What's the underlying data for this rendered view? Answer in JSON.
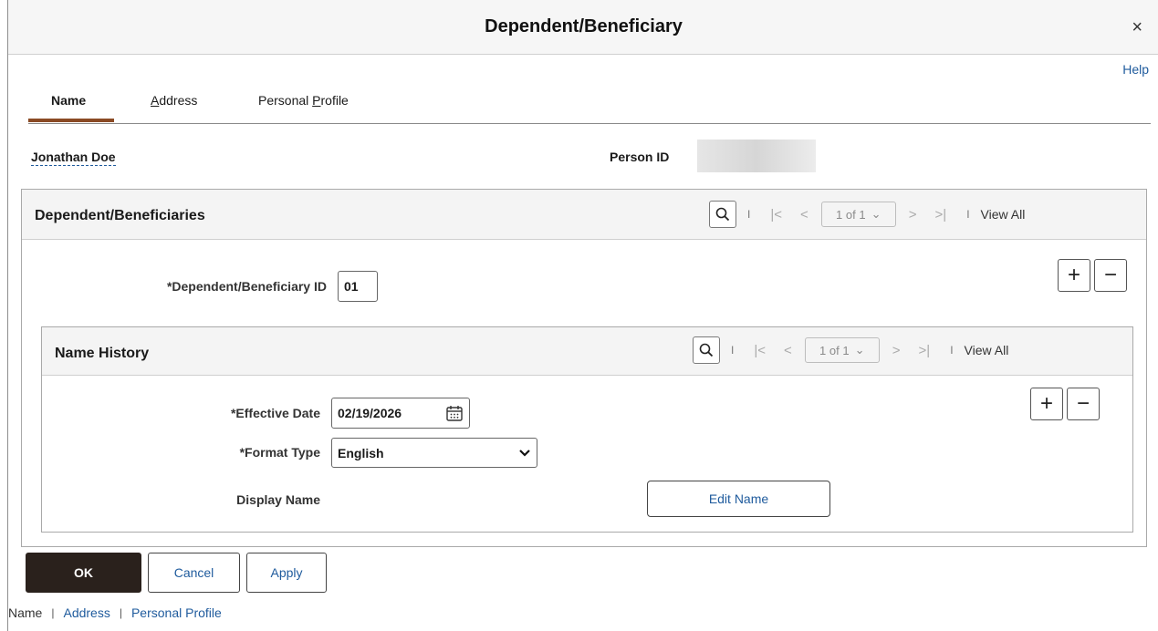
{
  "dialog": {
    "title": "Dependent/Beneficiary",
    "close": "×",
    "help": "Help"
  },
  "tabs": [
    {
      "label": "Name",
      "active": true
    },
    {
      "pre": "",
      "underlined": "A",
      "post": "ddress"
    },
    {
      "pre": "Personal ",
      "underlined": "P",
      "post": "rofile"
    }
  ],
  "person": {
    "name": "Jonathan Doe",
    "id_label": "Person ID"
  },
  "dependents_panel": {
    "title": "Dependent/Beneficiaries",
    "pager": "1 of 1",
    "view_all": "View All",
    "id_label": "*Dependent/Beneficiary ID",
    "id_value": "01"
  },
  "name_history": {
    "title": "Name History",
    "pager": "1 of 1",
    "view_all": "View All",
    "effective_date_label": "*Effective Date",
    "effective_date_value": "02/19/2026",
    "format_type_label": "*Format Type",
    "format_type_value": "English",
    "display_name_label": "Display Name",
    "edit_name": "Edit Name"
  },
  "buttons": {
    "ok": "OK",
    "cancel": "Cancel",
    "apply": "Apply"
  },
  "footer": {
    "name": "Name",
    "address": "Address",
    "profile": "Personal Profile",
    "sep": "|"
  },
  "icons": {
    "search": "search-icon",
    "calendar": "calendar-icon",
    "close": "close-icon",
    "plus": "plus-icon",
    "minus": "minus-icon"
  },
  "colors": {
    "link": "#1f5b9d",
    "tab_underline": "#8a4a24",
    "ok_button": "#2a211c"
  }
}
